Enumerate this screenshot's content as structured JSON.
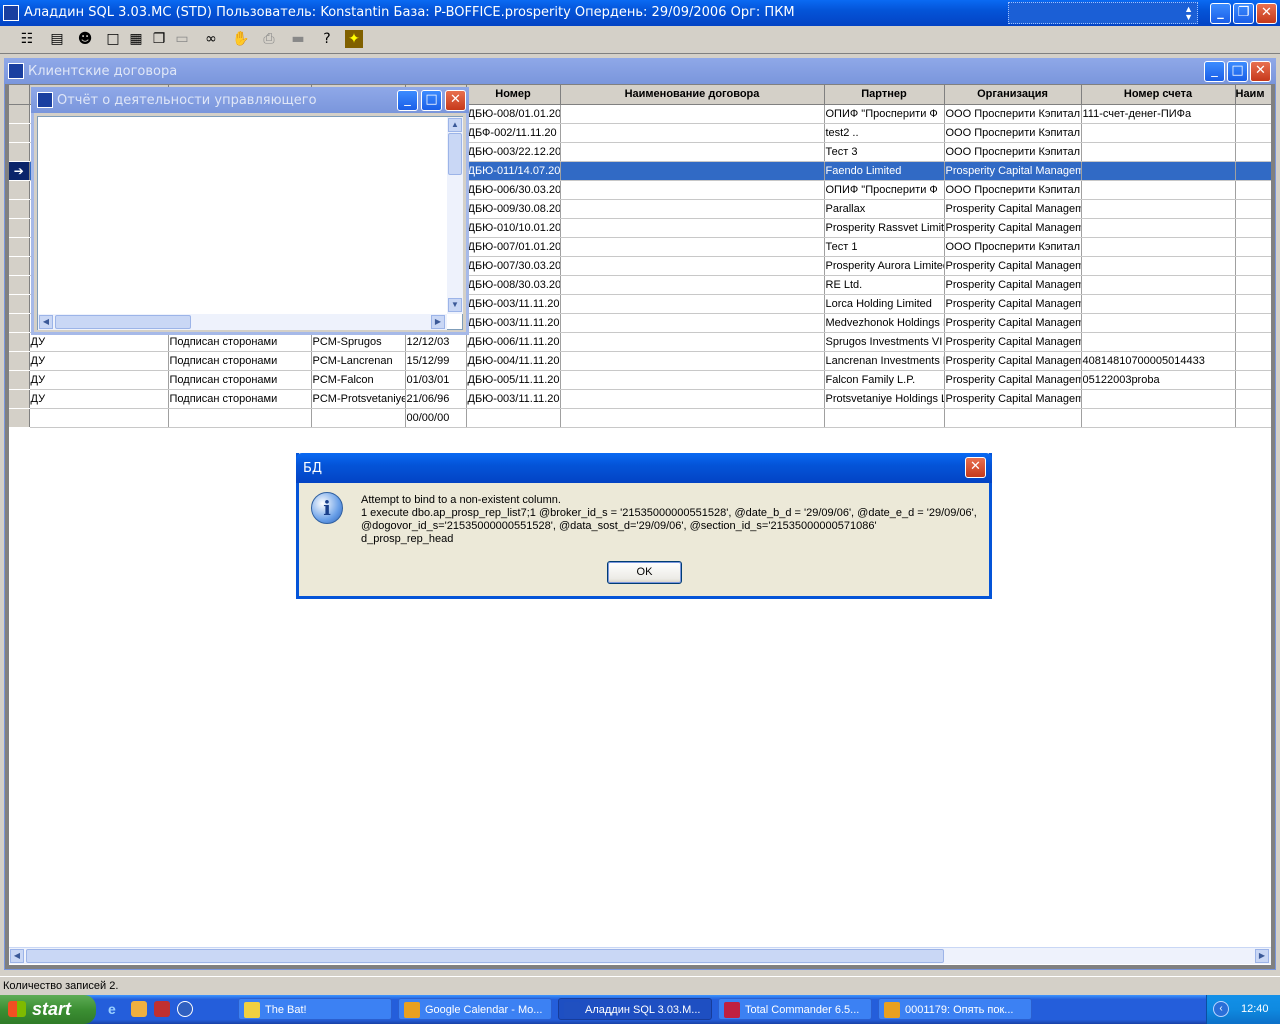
{
  "app": {
    "title": "Аладдин SQL 3.03.MC (STD)  Пользователь: Konstantin База: P-BOFFICE.prosperity Опердень: 29/09/2006 Орг: ПКМ"
  },
  "toolbar": {
    "icons": [
      "list-icon",
      "database-icon",
      "user-icon",
      "window-icon",
      "tile-icon",
      "cascade-icon",
      "minimize-all-icon",
      "binoculars-icon",
      "stop-icon",
      "print-icon",
      "export-icon",
      "help-icon",
      "exit-icon"
    ]
  },
  "contracts_window": {
    "title": "Клиентские договора",
    "columns": [
      "Номер",
      "Наименование договора",
      "Партнер",
      "Организация",
      "Номер счета",
      "Наим"
    ],
    "rows": [
      {
        "c1": "",
        "c2": "",
        "c3": "",
        "c4": "",
        "num": "ДБЮ-008/01.01.20",
        "name": "",
        "partner": "ОПИФ \"Просперити Ф",
        "org": "ООО Просперити Кэпитал",
        "acct": "111-счет-денег-ПИФа"
      },
      {
        "c1": "",
        "c2": "",
        "c3": "",
        "c4": "",
        "num": "ДБФ-002/11.11.20",
        "name": "",
        "partner": "test2 ..",
        "org": "ООО Просперити Кэпитал",
        "acct": ""
      },
      {
        "c1": "",
        "c2": "",
        "c3": "",
        "c4": "",
        "num": "ДБЮ-003/22.12.20",
        "name": "",
        "partner": "Тест 3",
        "org": "ООО Просперити Кэпитал",
        "acct": ""
      },
      {
        "c1": "",
        "c2": "",
        "c3": "",
        "c4": "",
        "num": "ДБЮ-011/14.07.20",
        "name": "",
        "partner": "Faendo Limited",
        "org": "Prosperity Capital Manageme",
        "acct": ""
      },
      {
        "c1": "",
        "c2": "",
        "c3": "",
        "c4": "",
        "num": "ДБЮ-006/30.03.20",
        "name": "",
        "partner": "ОПИФ \"Просперити Ф",
        "org": "ООО Просперити Кэпитал",
        "acct": ""
      },
      {
        "c1": "",
        "c2": "",
        "c3": "",
        "c4": "",
        "num": "ДБЮ-009/30.08.20",
        "name": "",
        "partner": "Parallax",
        "org": "Prosperity Capital Manageme",
        "acct": ""
      },
      {
        "c1": "",
        "c2": "",
        "c3": "",
        "c4": "",
        "num": "ДБЮ-010/10.01.20",
        "name": "",
        "partner": "Prosperity Rassvet Limite",
        "org": "Prosperity Capital Manageme",
        "acct": ""
      },
      {
        "c1": "",
        "c2": "",
        "c3": "",
        "c4": "",
        "num": "ДБЮ-007/01.01.20",
        "name": "",
        "partner": "Тест 1",
        "org": "ООО Просперити Кэпитал",
        "acct": ""
      },
      {
        "c1": "",
        "c2": "",
        "c3": "",
        "c4": "",
        "num": "ДБЮ-007/30.03.20",
        "name": "",
        "partner": "Prosperity Aurora Limited",
        "org": "Prosperity Capital Manageme",
        "acct": ""
      },
      {
        "c1": "",
        "c2": "",
        "c3": "",
        "c4": "",
        "num": "ДБЮ-008/30.03.20",
        "name": "",
        "partner": "RE Ltd.",
        "org": "Prosperity Capital Manageme",
        "acct": ""
      },
      {
        "c1": "",
        "c2": "",
        "c3": "",
        "c4": "",
        "num": "ДБЮ-003/11.11.20",
        "name": "",
        "partner": "Lorca Holding Limited",
        "org": "Prosperity Capital Manageme",
        "acct": ""
      },
      {
        "c1": "",
        "c2": "",
        "c3": "",
        "c4": "",
        "num": "ДБЮ-003/11.11.20",
        "name": "",
        "partner": "Medvezhonok Holdings I",
        "org": "Prosperity Capital Manageme",
        "acct": ""
      },
      {
        "c1": "ДУ",
        "c2": "Подписан сторонами",
        "c3": "PCM-Sprugos",
        "c4": "12/12/03",
        "num": "ДБЮ-006/11.11.20",
        "name": "",
        "partner": "Sprugos Investments VI",
        "org": "Prosperity Capital Manageme",
        "acct": ""
      },
      {
        "c1": "ДУ",
        "c2": "Подписан сторонами",
        "c3": "PCM-Lancrenan",
        "c4": "15/12/99",
        "num": "ДБЮ-004/11.11.20",
        "name": "",
        "partner": "Lancrenan Investments L",
        "org": "Prosperity Capital Manageme",
        "acct": "40814810700005014433"
      },
      {
        "c1": "ДУ",
        "c2": "Подписан сторонами",
        "c3": "PCM-Falcon",
        "c4": "01/03/01",
        "num": "ДБЮ-005/11.11.20",
        "name": "",
        "partner": "Falcon Family L.P.",
        "org": "Prosperity Capital Manageme",
        "acct": "05122003proba"
      },
      {
        "c1": "ДУ",
        "c2": "Подписан сторонами",
        "c3": "PCM-Protsvetaniye",
        "c4": "21/06/96",
        "num": "ДБЮ-003/11.11.20",
        "name": "",
        "partner": "Protsvetaniye Holdings L",
        "org": "Prosperity Capital Manageme",
        "acct": ""
      },
      {
        "c1": "",
        "c2": "",
        "c3": "",
        "c4": "00/00/00",
        "num": "",
        "name": "",
        "partner": "",
        "org": "",
        "acct": ""
      }
    ],
    "selected_row_index": 3,
    "selected_indicator": "➔"
  },
  "report_window": {
    "title": "Отчёт о деятельности управляющего"
  },
  "dialog": {
    "title": "БД",
    "lines": [
      "Attempt to bind to a non-existent column.",
      "1 execute dbo.ap_prosp_rep_list7;1 @broker_id_s = '21535000000551528', @date_b_d = '29/09/06', @date_e_d = '29/09/06',",
      "@dogovor_id_s='21535000000551528', @data_sost_d='29/09/06', @section_id_s='21535000000571086'",
      "d_prosp_rep_head"
    ],
    "ok_label": "OK"
  },
  "status_bar": {
    "text": "Количество записей 2."
  },
  "taskbar": {
    "start_label": "start",
    "tasks": [
      {
        "label": "The Bat!",
        "color": "#f0d040"
      },
      {
        "label": "Google Calendar - Mo...",
        "color": "#e8a020"
      },
      {
        "label": "Аладдин SQL 3.03.M...",
        "color": "#2050c0"
      },
      {
        "label": "Total Commander 6.5...",
        "color": "#c02040"
      },
      {
        "label": "0001179: Опять пок...",
        "color": "#e8a020"
      }
    ],
    "clock": "12:40"
  }
}
